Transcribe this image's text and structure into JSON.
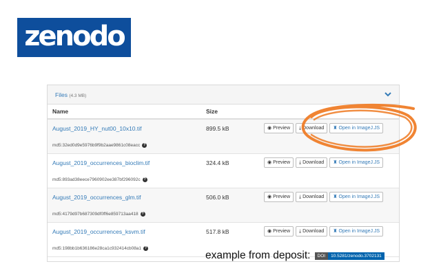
{
  "logo": {
    "text": "zenodo",
    "color": "#0e4e9c"
  },
  "panel": {
    "title": "Files",
    "total_size": "(4.3 MB)",
    "columns": {
      "name": "Name",
      "size": "Size"
    }
  },
  "buttons": {
    "preview": "Preview",
    "download": "Download",
    "open": "Open in ImageJ.JS"
  },
  "files": [
    {
      "name": "August_2019_HY_nut00_10x10.tif",
      "size": "899.5 kB",
      "md5": "md5:32ed0d9e5976b9f9b2aae9861c08eacc"
    },
    {
      "name": "August_2019_occurrences_bioclim.tif",
      "size": "324.4 kB",
      "md5": "md5:893ad38eece7960902ee387bf296092c"
    },
    {
      "name": "August_2019_occurrences_glm.tif",
      "size": "506.0 kB",
      "md5": "md5:4179d97b687309df0ff6e859713aa418"
    },
    {
      "name": "August_2019_occurrences_ksvm.tif",
      "size": "517.8 kB",
      "md5": "md5:198bb1b636186e28ca1c932414cb08a1"
    }
  ],
  "annotation": {
    "highlight_color": "#ef7a22"
  },
  "footer": {
    "example_text": "example from deposit:",
    "doi_label": "DOI",
    "doi_value": "10.5281/zenodo.3702131"
  }
}
